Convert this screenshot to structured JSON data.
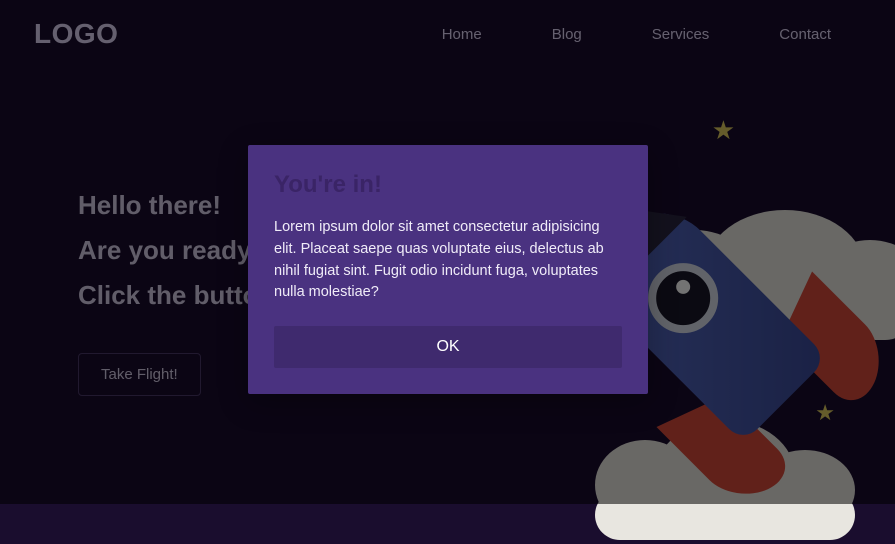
{
  "header": {
    "logo": "LOGO",
    "nav": {
      "home": "Home",
      "blog": "Blog",
      "services": "Services",
      "contact": "Contact"
    }
  },
  "hero": {
    "line1": "Hello there!",
    "line2": "Are you ready",
    "line3": "Click the button",
    "cta": "Take Flight!"
  },
  "modal": {
    "title": "You're in!",
    "body": "Lorem ipsum dolor sit amet consectetur adipisicing elit. Placeat saepe quas voluptate eius, delectus ab nihil fugiat sint. Fugit odio incidunt fuga, voluptates nulla molestiae?",
    "ok": "OK"
  }
}
